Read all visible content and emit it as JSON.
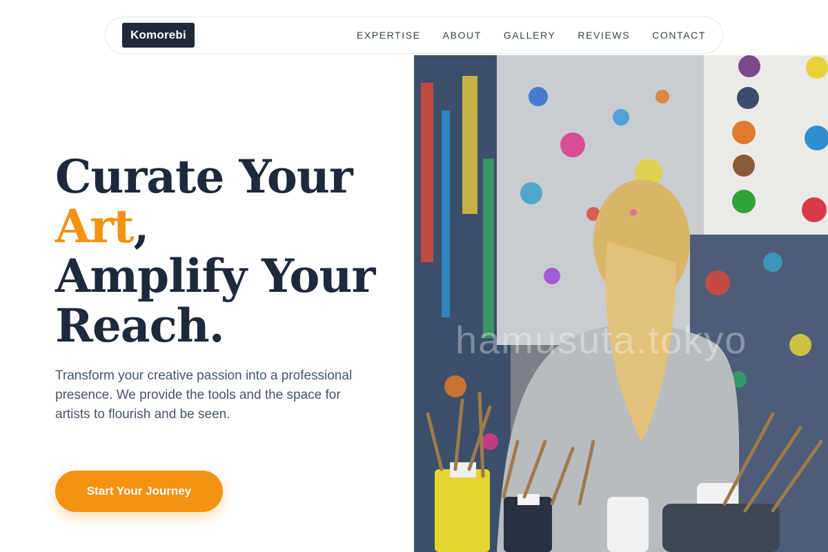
{
  "brand": {
    "name": "Komorebi"
  },
  "nav": {
    "items": [
      {
        "label": "EXPERTISE"
      },
      {
        "label": "ABOUT"
      },
      {
        "label": "GALLERY"
      },
      {
        "label": "REVIEWS"
      },
      {
        "label": "CONTACT"
      }
    ]
  },
  "hero": {
    "title_line1": "Curate Your",
    "title_accent": "Art",
    "title_comma": ",",
    "title_line3": "Amplify Your",
    "title_line4": "Reach.",
    "subtitle": "Transform your creative passion into a professional presence. We provide the tools and the space for artists to flourish and be seen.",
    "cta_label": "Start Your Journey",
    "watermark": "hamusuta.tokyo"
  },
  "colors": {
    "accent": "#f59113",
    "heading": "#1e293b",
    "body_text": "#475569",
    "logo_bg": "#1f2937"
  },
  "icons": {
    "image": "child-painting-studio-photo"
  }
}
